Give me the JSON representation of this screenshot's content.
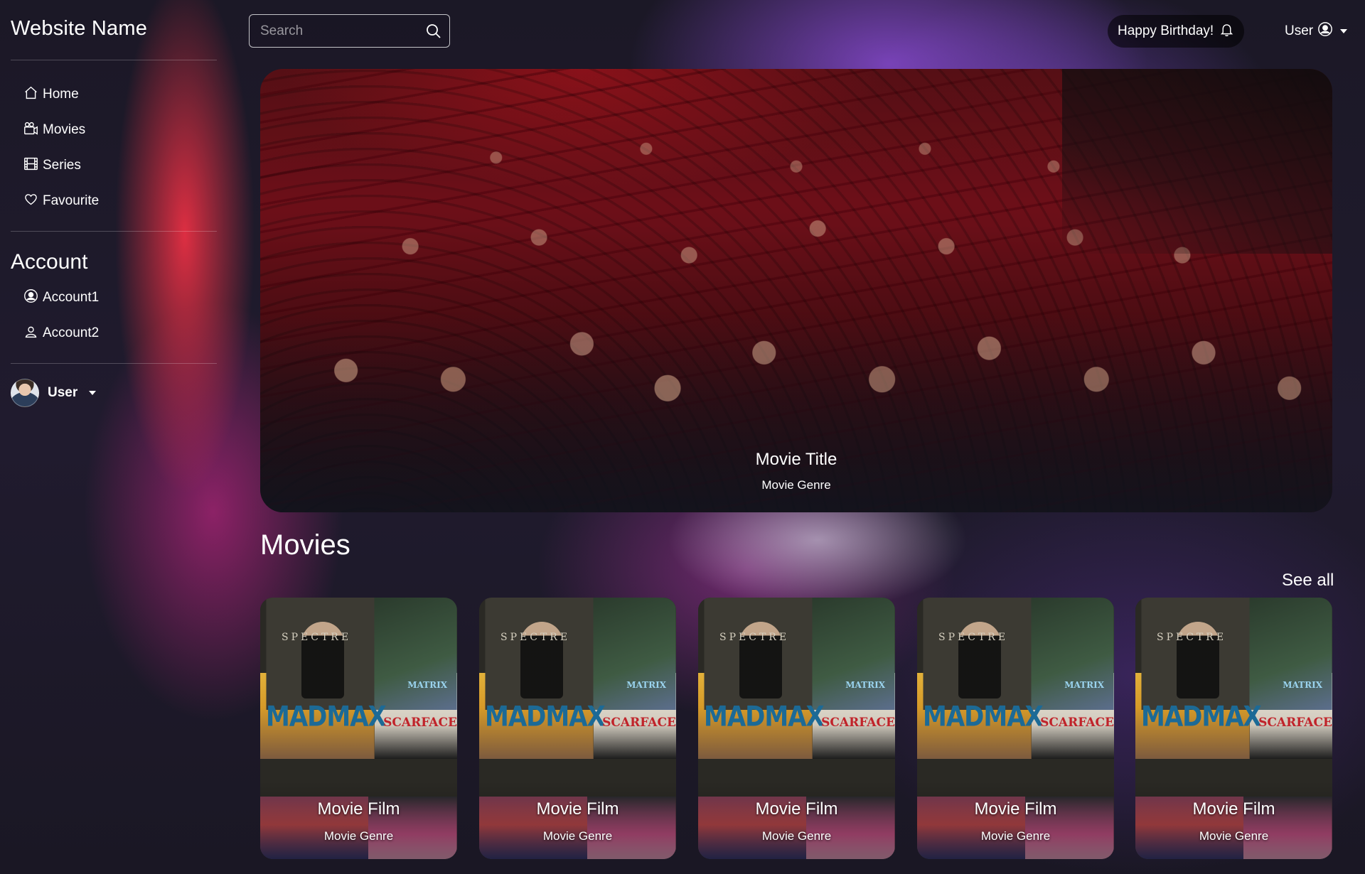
{
  "brand": {
    "name": "Website Name"
  },
  "sidebar": {
    "nav": [
      {
        "label": "Home",
        "icon": "house-icon"
      },
      {
        "label": "Movies",
        "icon": "film-camera-icon"
      },
      {
        "label": "Series",
        "icon": "film-strip-icon"
      },
      {
        "label": "Favourite",
        "icon": "heart-icon"
      }
    ],
    "account_title": "Account",
    "accounts": [
      {
        "label": "Account1",
        "icon": "user-circle-icon"
      },
      {
        "label": "Account2",
        "icon": "user-icon"
      }
    ],
    "user": {
      "label": "User",
      "icon": "avatar"
    }
  },
  "header": {
    "search": {
      "placeholder": "Search",
      "value": "",
      "icon": "search-icon"
    },
    "notification": {
      "label": "Happy Birthday!",
      "icon": "bell-icon"
    },
    "user": {
      "label": "User",
      "icon": "user-circle-icon"
    }
  },
  "hero": {
    "title": "Movie Title",
    "genre": "Movie Genre"
  },
  "movies": {
    "heading": "Movies",
    "see_all": "See all",
    "cards": [
      {
        "title": "Movie Film",
        "genre": "Movie Genre"
      },
      {
        "title": "Movie Film",
        "genre": "Movie Genre"
      },
      {
        "title": "Movie Film",
        "genre": "Movie Genre"
      },
      {
        "title": "Movie Film",
        "genre": "Movie Genre"
      },
      {
        "title": "Movie Film",
        "genre": "Movie Genre"
      }
    ],
    "poster_text": {
      "spectre": "SPECTRE",
      "matrix": "MATRIX",
      "madmax": "MADMAX",
      "scarface": "SCARFACE"
    }
  },
  "colors": {
    "text": "#ffffff",
    "divider": "rgba(255,255,255,0.22)",
    "notification_bg": "#000000"
  }
}
